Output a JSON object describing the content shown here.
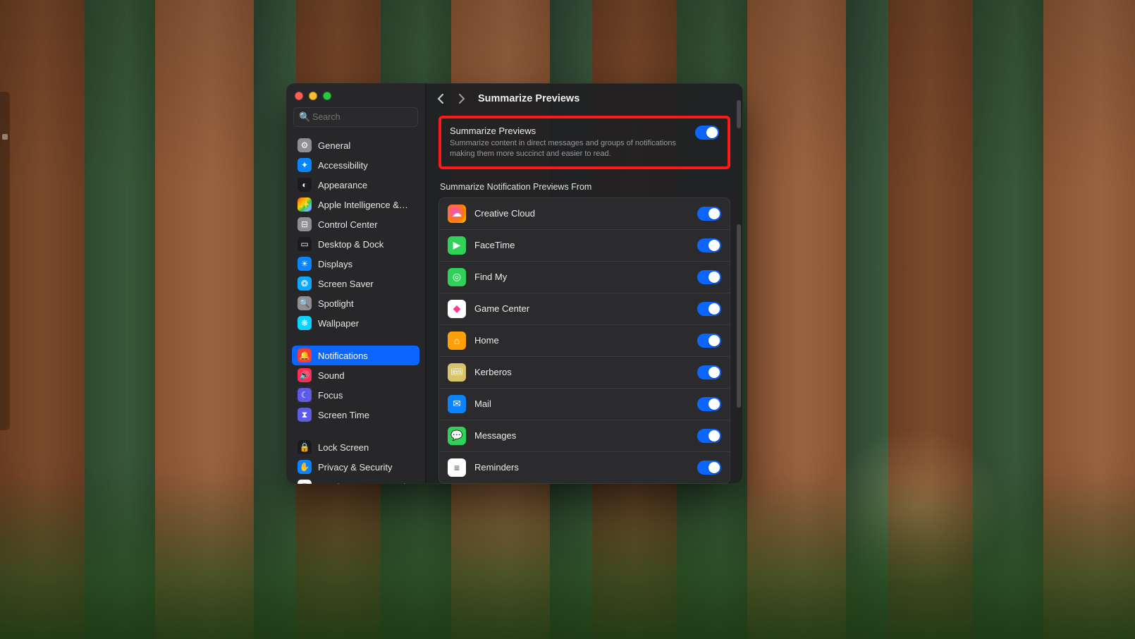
{
  "window": {
    "title": "Summarize Previews"
  },
  "search": {
    "placeholder": "Search"
  },
  "sidebar": {
    "groups": [
      [
        {
          "label": "General",
          "icon_bg": "#8e8e93",
          "glyph": "⚙"
        },
        {
          "label": "Accessibility",
          "icon_bg": "#0a84ff",
          "glyph": "✦"
        },
        {
          "label": "Appearance",
          "icon_bg": "#1c1c1e",
          "glyph": "◐"
        },
        {
          "label": "Apple Intelligence &…",
          "icon_bg": "linear-gradient(135deg,#ff2d55,#ff9500,#ffcc00,#34c759,#5ac8fa,#af52de)",
          "glyph": "✨"
        },
        {
          "label": "Control Center",
          "icon_bg": "#8e8e93",
          "glyph": "⊟"
        },
        {
          "label": "Desktop & Dock",
          "icon_bg": "#1c1c1e",
          "glyph": "▭"
        },
        {
          "label": "Displays",
          "icon_bg": "#0a84ff",
          "glyph": "☀"
        },
        {
          "label": "Screen Saver",
          "icon_bg": "#0aa8ff",
          "glyph": "❂"
        },
        {
          "label": "Spotlight",
          "icon_bg": "#8e8e93",
          "glyph": "🔍"
        },
        {
          "label": "Wallpaper",
          "icon_bg": "#0ad3ff",
          "glyph": "❋"
        }
      ],
      [
        {
          "label": "Notifications",
          "icon_bg": "#ff3b30",
          "glyph": "🔔",
          "selected": true
        },
        {
          "label": "Sound",
          "icon_bg": "#ff2d55",
          "glyph": "🔊"
        },
        {
          "label": "Focus",
          "icon_bg": "#5e5ce6",
          "glyph": "☾"
        },
        {
          "label": "Screen Time",
          "icon_bg": "#5e5ce6",
          "glyph": "⧗"
        }
      ],
      [
        {
          "label": "Lock Screen",
          "icon_bg": "#1c1c1e",
          "glyph": "🔒"
        },
        {
          "label": "Privacy & Security",
          "icon_bg": "#0a84ff",
          "glyph": "✋"
        },
        {
          "label": "Touch ID & Password",
          "icon_bg": "#ffffff",
          "glyph": "⦿",
          "glyph_color": "#ff3b30"
        }
      ]
    ]
  },
  "main": {
    "summarize": {
      "title": "Summarize Previews",
      "desc": "Summarize content in direct messages and groups of notifications making them more succinct and easier to read.",
      "on": true
    },
    "section_label": "Summarize Notification Previews From",
    "apps": [
      {
        "name": "Creative Cloud",
        "icon_bg": "radial-gradient(circle at 40% 40%, #ff4bd8 0%, #ff7a00 60%, #ffd400 100%)",
        "glyph": "☁",
        "on": true
      },
      {
        "name": "FaceTime",
        "icon_bg": "#30d158",
        "glyph": "▶",
        "on": true
      },
      {
        "name": "Find My",
        "icon_bg": "#30d158",
        "glyph": "◎",
        "on": true
      },
      {
        "name": "Game Center",
        "icon_bg": "#ffffff",
        "glyph": "◆",
        "glyph_color": "#ff3b8d",
        "on": true
      },
      {
        "name": "Home",
        "icon_bg": "#ff9f0a",
        "glyph": "⌂",
        "on": true
      },
      {
        "name": "Kerberos",
        "icon_bg": "#d9c36a",
        "glyph": "🎟",
        "on": true
      },
      {
        "name": "Mail",
        "icon_bg": "#0a84ff",
        "glyph": "✉",
        "on": true
      },
      {
        "name": "Messages",
        "icon_bg": "#30d158",
        "glyph": "💬",
        "on": true
      },
      {
        "name": "Reminders",
        "icon_bg": "#ffffff",
        "glyph": "≡",
        "glyph_color": "#444",
        "on": true
      }
    ]
  }
}
